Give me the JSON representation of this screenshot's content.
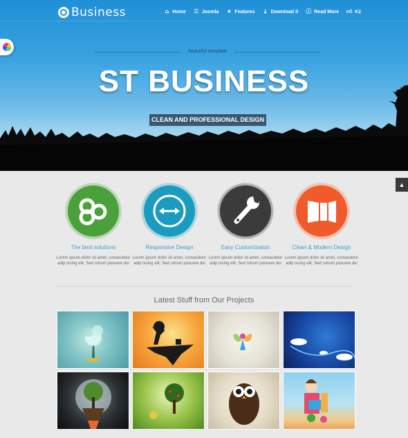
{
  "brand": {
    "logo_text": "Business"
  },
  "nav": {
    "items": [
      {
        "label": "Home",
        "icon": "home-icon"
      },
      {
        "label": "Joomla",
        "icon": "list-icon"
      },
      {
        "label": "Features",
        "icon": "star-icon"
      },
      {
        "label": "Download it",
        "icon": "download-icon"
      },
      {
        "label": "Read More",
        "icon": "info-icon"
      },
      {
        "label": "K2",
        "icon": "thumbs-up-icon"
      }
    ]
  },
  "hero": {
    "tagline": "beautiful template",
    "title": "ST BUSINESS",
    "subtitle": "CLEAN AND PROFESSIONAL DESIGN"
  },
  "features": [
    {
      "title": "The best solutions",
      "text": "Lorem ipsum dolor sit amet, consectetur adip iscing elit. Sed rutrum posuere dui",
      "color": "#4aa03a",
      "icon": "cluster-icon"
    },
    {
      "title": "Responsive Design",
      "text": "Lorem ipsum dolor sit amet, consectetur adip iscing elit. Sed rutrum posuere dui",
      "color": "#1b9bbf",
      "icon": "arrows-horizontal-icon"
    },
    {
      "title": "Easy Customization",
      "text": "Lorem ipsum dolor sit amet, consectetur adip iscing elit. Sed rutrum posuere dui",
      "color": "#3b3b3b",
      "icon": "wrench-icon"
    },
    {
      "title": "Clean & Modern Design",
      "text": "Lorem ipsum dolor sit amet, consectetur adip iscing elit. Sed rutrum posuere dui",
      "color": "#ef5b2a",
      "icon": "layout-icon"
    }
  ],
  "projects": {
    "title": "Latest Stuff from Our Projects"
  },
  "colors": {
    "accent": "#3a9fc9",
    "hero_sky": "#3aa3e0"
  }
}
